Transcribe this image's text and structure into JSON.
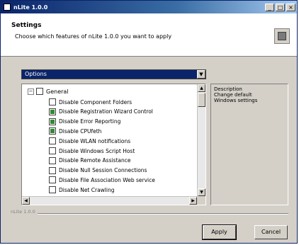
{
  "window": {
    "title": "nLite 1.0.0",
    "controls": [
      "_",
      "□",
      "×"
    ]
  },
  "header": {
    "title": "Settings",
    "subtitle": "Choose which features of nLite 1.0.0 you want to apply"
  },
  "category": {
    "selected": "Options"
  },
  "tree": {
    "root_label": "General",
    "items": [
      {
        "label": "Disable Component Folders",
        "checked": false
      },
      {
        "label": "Disable Registration Wizard Control",
        "checked": true
      },
      {
        "label": "Disable Error Reporting",
        "checked": true
      },
      {
        "label": "Disable CPUfeth",
        "checked": true
      },
      {
        "label": "Disable WLAN notifications",
        "checked": false
      },
      {
        "label": "Disable Windows Script Host",
        "checked": false
      },
      {
        "label": "Disable Remote Assistance",
        "checked": false
      },
      {
        "label": "Disable Null Session Connections",
        "checked": false
      },
      {
        "label": "Disable File Association Web service",
        "checked": false
      },
      {
        "label": "Disable Net Crawling",
        "checked": false
      }
    ]
  },
  "description": {
    "lines": [
      "Description",
      "Change default",
      "Windows settings"
    ]
  },
  "footer": {
    "brand": "nLite 1.0.0"
  },
  "buttons": {
    "apply": "Apply",
    "cancel": "Cancel"
  }
}
